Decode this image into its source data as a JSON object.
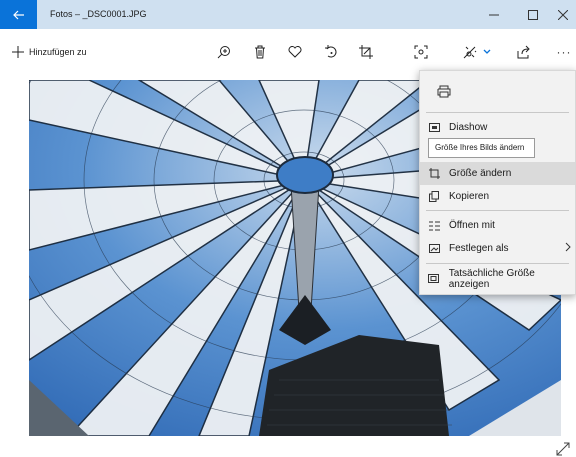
{
  "window": {
    "title": "Fotos – _DSC0001.JPG",
    "accent_color": "#0a73d9",
    "titlebar_color": "#cfe0f0"
  },
  "toolbar": {
    "add_to_label": "Hinzufügen zu",
    "icons": [
      "zoom-in-icon",
      "delete-icon",
      "favorite-icon",
      "rotate-icon",
      "crop-icon",
      "enhance-icon",
      "edit-create-icon",
      "share-icon",
      "more-icon"
    ],
    "more_label": "···"
  },
  "menu": {
    "items": [
      {
        "label": "Diashow",
        "icon": "slideshow-icon"
      },
      {
        "label": "Größe ändern",
        "icon": "resize-icon",
        "highlighted": true
      },
      {
        "label": "Kopieren",
        "icon": "copy-icon"
      },
      {
        "label": "Öffnen mit",
        "icon": "open-with-icon"
      },
      {
        "label": "Festlegen als",
        "icon": "set-as-icon",
        "has_submenu": true
      },
      {
        "label": "Tatsächliche Größe anzeigen",
        "icon": "actual-size-icon"
      }
    ],
    "tooltip": "Größe Ihres Bilds ändern"
  }
}
